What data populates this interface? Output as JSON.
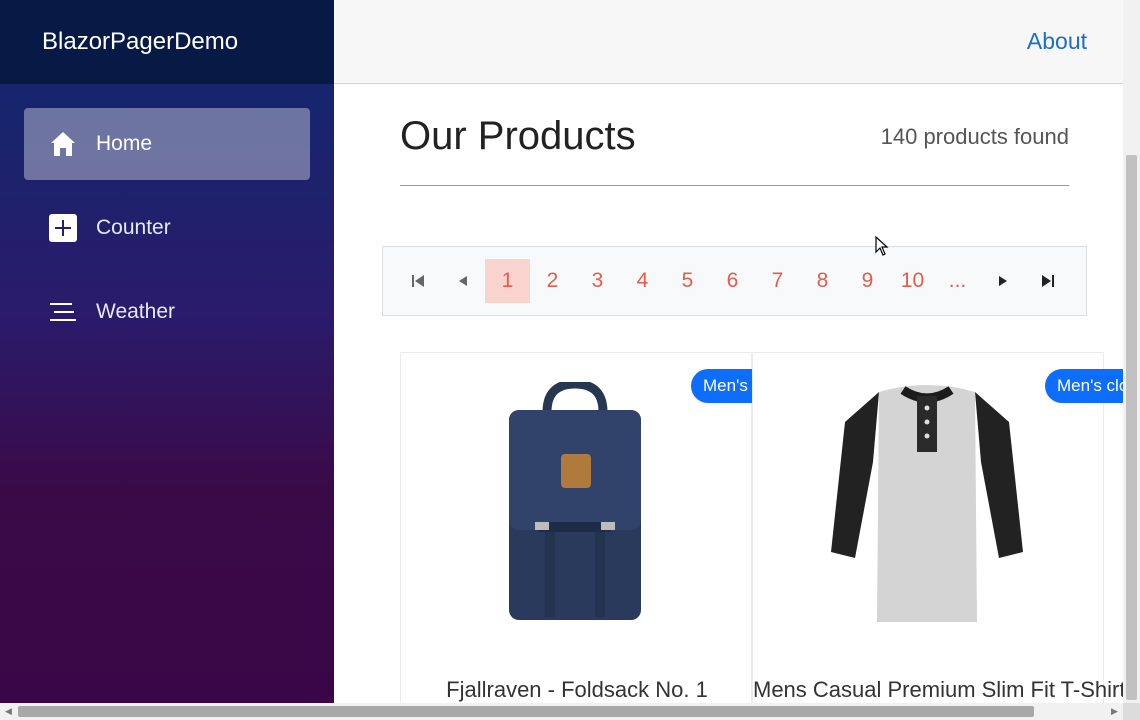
{
  "app": {
    "brand": "BlazorPagerDemo"
  },
  "sidebar": {
    "items": [
      {
        "label": "Home",
        "icon": "home-icon",
        "active": true
      },
      {
        "label": "Counter",
        "icon": "plus-square-icon",
        "active": false
      },
      {
        "label": "Weather",
        "icon": "list-lines-icon",
        "active": false
      }
    ]
  },
  "topbar": {
    "about_label": "About"
  },
  "main": {
    "title": "Our Products",
    "count_text": "140 products found"
  },
  "pager": {
    "pages": [
      "1",
      "2",
      "3",
      "4",
      "5",
      "6",
      "7",
      "8",
      "9",
      "10"
    ],
    "ellipsis": "...",
    "current": "1"
  },
  "products": [
    {
      "title": "Fjallraven - Foldsack No. 1",
      "category": "Men's clothing",
      "image": "backpack"
    },
    {
      "title": "Mens Casual Premium Slim Fit T-Shirts",
      "category": "Men's clothing",
      "image": "henley-shirt"
    }
  ],
  "colors": {
    "accent_link": "#1b6ec2",
    "pager_text": "#e35d4a",
    "pager_active_bg": "#f9d4cf",
    "badge": "#0d6efd"
  }
}
